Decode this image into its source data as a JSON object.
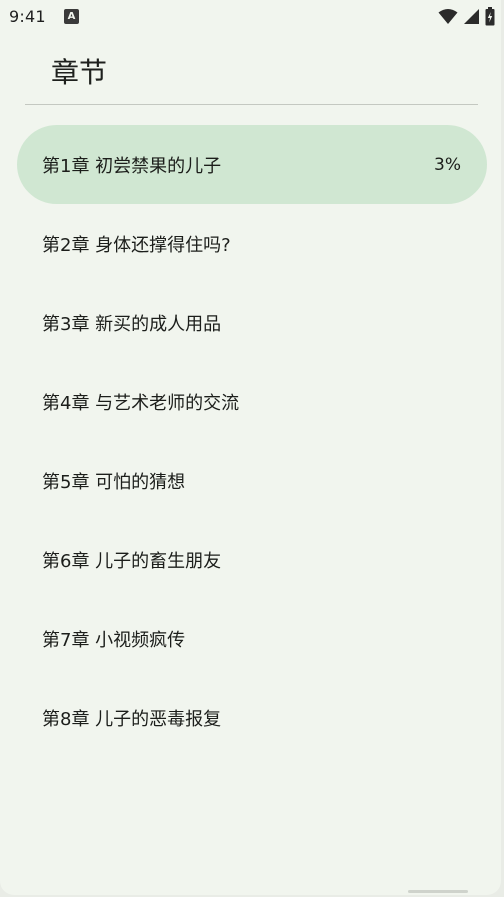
{
  "status_bar": {
    "time": "9:41",
    "notification_icon": "A",
    "icons": [
      "wifi-icon",
      "signal-icon",
      "battery-icon"
    ]
  },
  "header": {
    "title": "章节"
  },
  "chapters": [
    {
      "title": "第1章 初尝禁果的儿子",
      "progress": "3%",
      "active": true
    },
    {
      "title": "第2章 身体还撑得住吗?",
      "progress": "",
      "active": false
    },
    {
      "title": "第3章 新买的成人用品",
      "progress": "",
      "active": false
    },
    {
      "title": "第4章 与艺术老师的交流",
      "progress": "",
      "active": false
    },
    {
      "title": "第5章 可怕的猜想",
      "progress": "",
      "active": false
    },
    {
      "title": "第6章 儿子的畜生朋友",
      "progress": "",
      "active": false
    },
    {
      "title": "第7章 小视频疯传",
      "progress": "",
      "active": false
    },
    {
      "title": "第8章 儿子的恶毒报复",
      "progress": "",
      "active": false
    }
  ],
  "colors": {
    "background": "#f1f5ee",
    "active_item": "#d0e7d2",
    "divider": "#c4c8c1"
  }
}
